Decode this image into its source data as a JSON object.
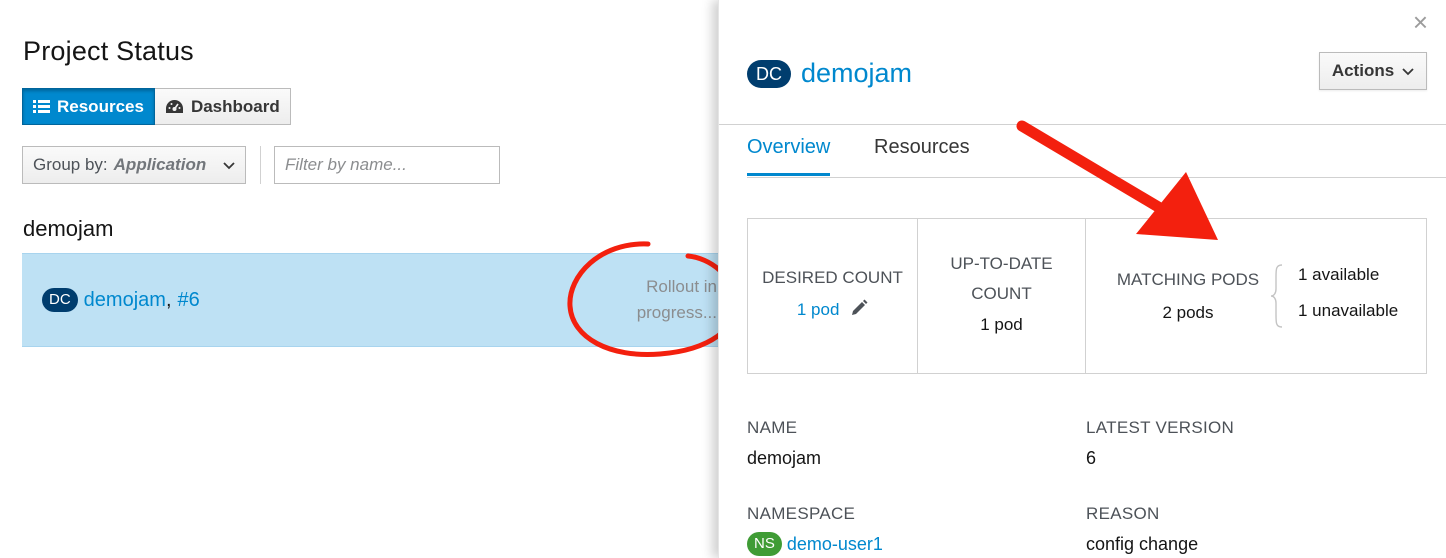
{
  "left": {
    "page_title": "Project Status",
    "view_toggle": {
      "resources_label": "Resources",
      "dashboard_label": "Dashboard"
    },
    "group_by": {
      "label": "Group by:",
      "value": "Application"
    },
    "filter": {
      "placeholder": "Filter by name..."
    },
    "app_group": {
      "name": "demojam",
      "row": {
        "kind_badge": "DC",
        "name": "demojam",
        "separator": ",",
        "version": "#6",
        "status_line1": "Rollout in",
        "status_line2": "progress..."
      }
    }
  },
  "drawer": {
    "close_glyph": "×",
    "kind_badge": "DC",
    "title": "demojam",
    "actions_label": "Actions",
    "tabs": [
      {
        "label": "Overview",
        "active": true
      },
      {
        "label": "Resources",
        "active": false
      }
    ],
    "stats": {
      "desired_count": {
        "label": "Desired Count",
        "value": "1 pod"
      },
      "up_to_date": {
        "label_line1": "Up-to-date",
        "label_line2": "Count",
        "value": "1 pod"
      },
      "matching_pods": {
        "label": "Matching Pods",
        "value": "2 pods",
        "available": "1 available",
        "unavailable": "1 unavailable"
      }
    },
    "details": {
      "name_label": "NAME",
      "name_value": "demojam",
      "latest_version_label": "LATEST VERSION",
      "latest_version_value": "6",
      "namespace_label": "NAMESPACE",
      "namespace_badge": "NS",
      "namespace_value": "demo-user1",
      "reason_label": "REASON",
      "reason_value": "config change"
    }
  },
  "colors": {
    "accent": "#0088ce",
    "selected_row": "#bee1f4",
    "dc_badge": "#003d6e",
    "ns_badge": "#3f9c35",
    "annotation": "#f3200e"
  },
  "icons": [
    "list-icon",
    "dashboard-icon",
    "caret-down-icon",
    "close-icon",
    "pencil-icon"
  ]
}
